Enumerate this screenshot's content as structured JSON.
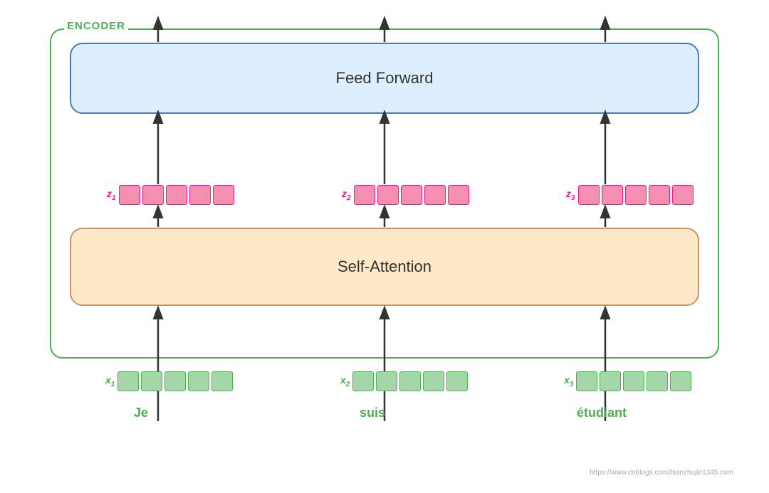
{
  "diagram": {
    "encoder_label": "ENCODER",
    "ff_label": "Feed Forward",
    "sa_label": "Self-Attention",
    "z_labels": [
      "z",
      "z",
      "z"
    ],
    "z_subscripts": [
      "1",
      "2",
      "3"
    ],
    "x_labels": [
      "x",
      "x",
      "x"
    ],
    "x_subscripts": [
      "1",
      "2",
      "3"
    ],
    "words": [
      "Je",
      "suis",
      "étudiant"
    ],
    "cell_count": 5,
    "colors": {
      "encoder_border": "#4CAF50",
      "ff_bg": "#ddeeff",
      "ff_border": "#4a7cb5",
      "sa_bg": "#fde8c8",
      "sa_border": "#c8956a",
      "pink_cell": "#f48fb1",
      "pink_border": "#e91e8c",
      "green_cell": "#a5d6a7",
      "green_border": "#4CAF50",
      "z_label_color": "#e91e8c",
      "x_label_color": "#4CAF50",
      "word_color": "#4CAF50",
      "arrow_color": "#333333"
    },
    "watermark": "https://www.cnblogs.com/bianzhujie1345.com"
  }
}
